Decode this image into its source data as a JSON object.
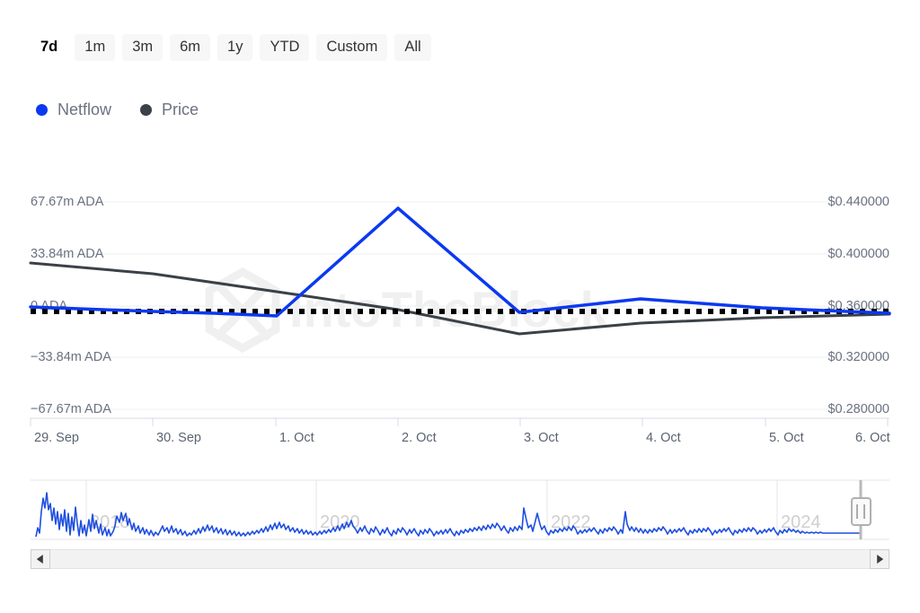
{
  "range_selector": {
    "buttons": [
      {
        "label": "7d",
        "selected": true
      },
      {
        "label": "1m",
        "selected": false
      },
      {
        "label": "3m",
        "selected": false
      },
      {
        "label": "6m",
        "selected": false
      },
      {
        "label": "1y",
        "selected": false
      },
      {
        "label": "YTD",
        "selected": false
      },
      {
        "label": "Custom",
        "selected": false
      },
      {
        "label": "All",
        "selected": false
      }
    ]
  },
  "legend": {
    "items": [
      {
        "label": "Netflow",
        "color": "#0b39f0"
      },
      {
        "label": "Price",
        "color": "#3b4148"
      }
    ]
  },
  "watermark": {
    "text": "IntoTheBlock",
    "logo": "hexagon-logo-icon",
    "color": "#f0f0f0"
  },
  "chart_data": {
    "type": "line",
    "title": "",
    "xlabel": "",
    "grid": true,
    "legend_position": "top-left",
    "x": [
      "29. Sep",
      "30. Sep",
      "1. Oct",
      "2. Oct",
      "3. Oct",
      "4. Oct",
      "5. Oct",
      "6. Oct"
    ],
    "x_tick_labels": [
      "29. Sep",
      "30. Sep",
      "1. Oct",
      "2. Oct",
      "3. Oct",
      "4. Oct",
      "5. Oct",
      "6. Oct"
    ],
    "axes": {
      "left": {
        "label": "Netflow",
        "unit": "ADA",
        "tick_labels": [
          "67.67m ADA",
          "33.84m ADA",
          "0 ADA",
          "−33.84m ADA",
          "−67.67m ADA"
        ],
        "tick_values": [
          67670000,
          33840000,
          0,
          -33840000,
          -67670000
        ],
        "ylim": [
          -84587500,
          84587500
        ]
      },
      "right": {
        "label": "Price",
        "unit": "USD",
        "tick_labels": [
          "$0.440000",
          "$0.400000",
          "$0.360000",
          "$0.320000",
          "$0.280000"
        ],
        "tick_values": [
          0.44,
          0.4,
          0.36,
          0.32,
          0.28
        ],
        "ylim": [
          0.26,
          0.46
        ]
      }
    },
    "zero_line": {
      "value": 0,
      "style": "dotted",
      "color": "#000000"
    },
    "series": [
      {
        "name": "Netflow",
        "color": "#0b39f0",
        "axis": "left",
        "unit": "ADA",
        "values": [
          -1200000,
          -5500000,
          -6800000,
          64800000,
          -2400000,
          4800000,
          7400000,
          1800000,
          -800000
        ]
      },
      {
        "name": "Price",
        "color": "#3b4148",
        "axis": "right",
        "unit": "USD",
        "values": [
          0.3925,
          0.3845,
          0.3705,
          0.3565,
          0.3445,
          0.3305,
          0.3355,
          0.3395,
          0.3425
        ]
      }
    ]
  },
  "navigator": {
    "year_labels": [
      "2018",
      "2020",
      "2022",
      "2024"
    ],
    "handle": "right-range-handle",
    "series_color": "#1f4fe0"
  },
  "scrollbar": {
    "left_arrow": "scroll-left-arrow-icon",
    "right_arrow": "scroll-right-arrow-icon"
  }
}
